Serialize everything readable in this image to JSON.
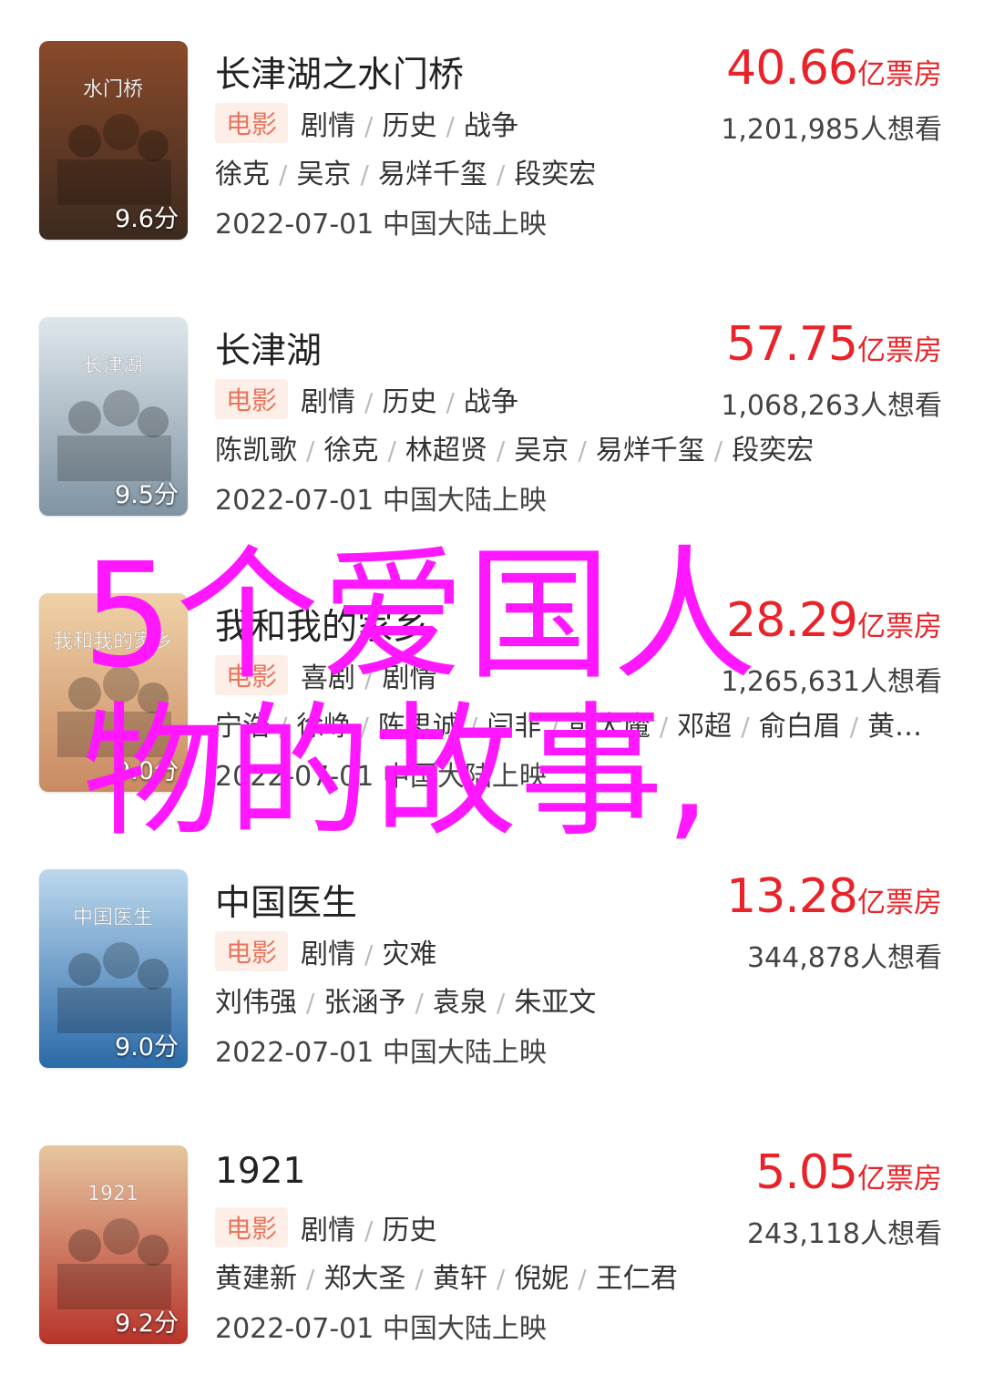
{
  "movies": [
    {
      "title": "长津湖之水门桥",
      "tag": "电影",
      "genres": [
        "剧情",
        "历史",
        "战争"
      ],
      "cast": [
        "徐克",
        "吴京",
        "易烊千玺",
        "段奕宏"
      ],
      "release": "2022-07-01 中国大陆上映",
      "box_number": "40.66",
      "box_unit": "亿票房",
      "wish": "1,201,985人想看",
      "score": "9.6分",
      "poster_text": "水门桥",
      "poster_colors": [
        "#3b2a1f",
        "#8a4a2a"
      ]
    },
    {
      "title": "长津湖",
      "tag": "电影",
      "genres": [
        "剧情",
        "历史",
        "战争"
      ],
      "cast": [
        "陈凯歌",
        "徐克",
        "林超贤",
        "吴京",
        "易烊千玺",
        "段奕宏"
      ],
      "release": "2022-07-01 中国大陆上映",
      "box_number": "57.75",
      "box_unit": "亿票房",
      "wish": "1,068,263人想看",
      "score": "9.5分",
      "poster_text": "长津湖",
      "poster_colors": [
        "#7f93a3",
        "#dfe7ec"
      ]
    },
    {
      "title": "我和我的家乡",
      "tag": "电影",
      "genres": [
        "喜剧",
        "剧情"
      ],
      "cast": [
        "宁浩",
        "徐峥",
        "陈思诚",
        "闫非",
        "彭大魔",
        "邓超",
        "俞白眉",
        "黄…"
      ],
      "release": "2022-07-01 中国大陆上映",
      "box_number": "28.29",
      "box_unit": "亿票房",
      "wish": "1,265,631人想看",
      "score": "9.0分",
      "poster_text": "我和我的家乡",
      "poster_colors": [
        "#c98a62",
        "#f0d2a8"
      ]
    },
    {
      "title": "中国医生",
      "tag": "电影",
      "genres": [
        "剧情",
        "灾难"
      ],
      "cast": [
        "刘伟强",
        "张涵予",
        "袁泉",
        "朱亚文"
      ],
      "release": "2022-07-01 中国大陆上映",
      "box_number": "13.28",
      "box_unit": "亿票房",
      "wish": "344,878人想看",
      "score": "9.0分",
      "poster_text": "中国医生",
      "poster_colors": [
        "#2a6aa8",
        "#bcd8ee"
      ]
    },
    {
      "title": "1921",
      "tag": "电影",
      "genres": [
        "剧情",
        "历史"
      ],
      "cast": [
        "黄建新",
        "郑大圣",
        "黄轩",
        "倪妮",
        "王仁君"
      ],
      "release": "2022-07-01 中国大陆上映",
      "box_number": "5.05",
      "box_unit": "亿票房",
      "wish": "243,118人想看",
      "score": "9.2分",
      "poster_text": "1921",
      "poster_colors": [
        "#b8332a",
        "#e7c7a0"
      ]
    }
  ],
  "overlay_text_line1": "5个爱国人",
  "overlay_text_line2": "物的故事,"
}
